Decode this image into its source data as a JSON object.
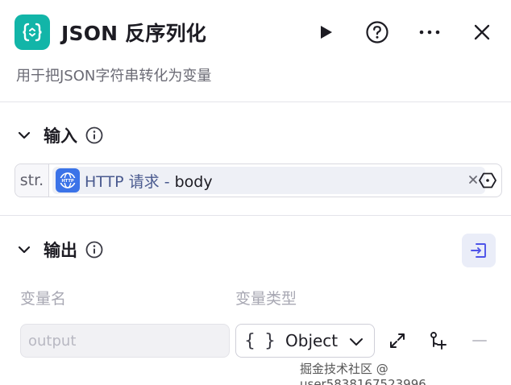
{
  "header": {
    "title": "JSON 反序列化",
    "description": "用于把JSON字符串转化为变量",
    "logo_icon": "json-braces-icon",
    "accent_color": "#12b5a8"
  },
  "input_section": {
    "label": "输入",
    "param": {
      "type_tag": "str.",
      "ref_node_icon": "http-globe-icon",
      "ref_node_name": "HTTP 请求",
      "ref_separator": " - ",
      "ref_field": "body"
    }
  },
  "output_section": {
    "label": "输出",
    "columns": {
      "name": "变量名",
      "type": "变量类型"
    },
    "row": {
      "name_placeholder": "output",
      "type_glyph": "{ }",
      "type_value": "Object"
    }
  },
  "watermark": "掘金技术社区 @ user5838167523996"
}
